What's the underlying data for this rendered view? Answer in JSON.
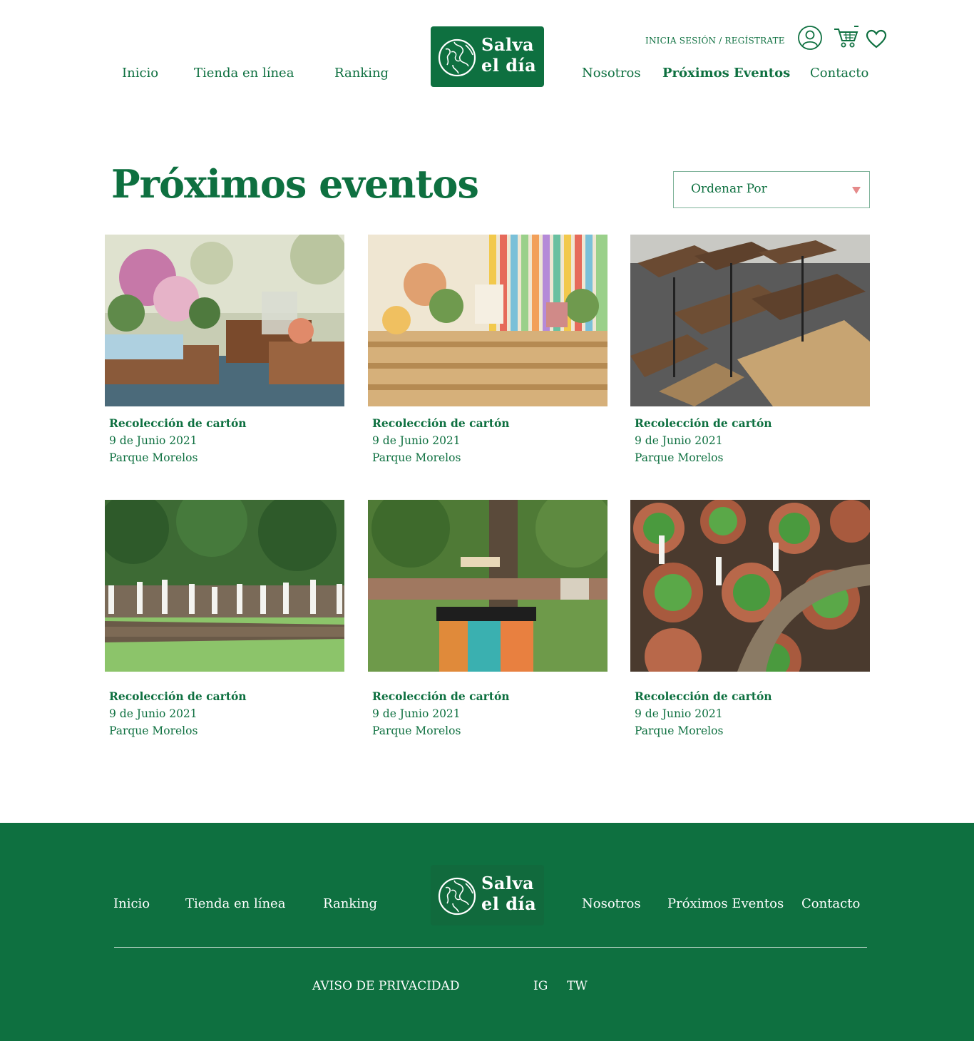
{
  "header": {
    "nav_left": [
      "Inicio",
      "Tienda en línea",
      "Ranking"
    ],
    "nav_right": [
      "Nosotros",
      "Próximos Eventos",
      "Contacto"
    ],
    "active_item": "Próximos Eventos",
    "logo_line1": "Salva",
    "logo_line2": "el día",
    "auth_link": "INICIA SESIÓN / REGÍSTRATE",
    "icons": [
      "user-icon",
      "cart-icon",
      "heart-icon"
    ]
  },
  "main": {
    "title": "Próximos eventos",
    "sort_label": "Ordenar Por",
    "events": [
      {
        "title": "Recolección de cartón",
        "date": "9 de Junio 2021",
        "place": "Parque Morelos",
        "image": "event-table-flowers-photo"
      },
      {
        "title": "Recolección de cartón",
        "date": "9 de Junio 2021",
        "place": "Parque Morelos",
        "image": "event-pallet-dessert-table-photo"
      },
      {
        "title": "Recolección de cartón",
        "date": "9 de Junio 2021",
        "place": "Parque Morelos",
        "image": "event-chairs-bags-photo"
      },
      {
        "title": "Recolección de cartón",
        "date": "9 de Junio 2021",
        "place": "Parque Morelos",
        "image": "event-forest-group-photo"
      },
      {
        "title": "Recolección de cartón",
        "date": "9 de Junio 2021",
        "place": "Parque Morelos",
        "image": "event-compost-bins-photo"
      },
      {
        "title": "Recolección de cartón",
        "date": "9 de Junio 2021",
        "place": "Parque Morelos",
        "image": "event-seedlings-pots-photo"
      }
    ]
  },
  "footer": {
    "nav_left": [
      "Inicio",
      "Tienda en línea",
      "Ranking"
    ],
    "nav_right": [
      "Nosotros",
      "Próximos Eventos",
      "Contacto"
    ],
    "logo_line1": "Salva",
    "logo_line2": "el día",
    "privacy": "AVISO DE PRIVACIDAD",
    "social": [
      "IG",
      "TW"
    ]
  },
  "colors": {
    "brand_green": "#0e7040",
    "sort_caret": "#e58a8a",
    "background": "#ffffff"
  }
}
